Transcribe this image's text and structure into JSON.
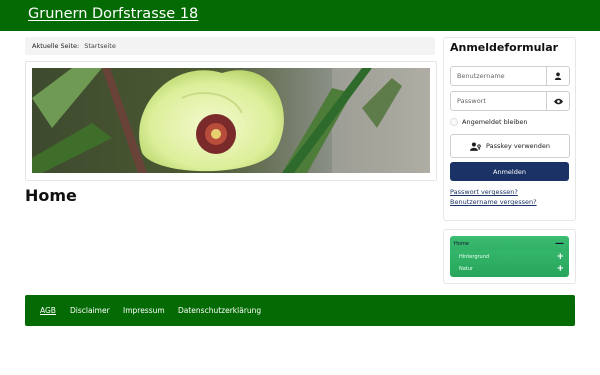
{
  "header": {
    "site_title": "Grunern Dorfstrasse 18"
  },
  "breadcrumb": {
    "label": "Aktuelle Seite:",
    "current": "Startseite"
  },
  "main": {
    "title": "Home"
  },
  "login": {
    "title": "Anmeldeformular",
    "username_placeholder": "Benutzername",
    "password_placeholder": "Passwort",
    "remember_label": "Angemeldet bleiben",
    "passkey_label": "Passkey verwenden",
    "submit_label": "Anmelden",
    "forgot_password": "Passwort vergessen?",
    "forgot_username": "Benutzername vergessen?"
  },
  "nav_menu": {
    "items": [
      {
        "label": "Home",
        "icon": "minus-icon"
      },
      {
        "label": "Hintergrund",
        "icon": "plus-icon"
      },
      {
        "label": "Natur",
        "icon": "plus-icon"
      }
    ]
  },
  "footer": {
    "links": [
      "AGB",
      "Disclaimer",
      "Impressum",
      "Datenschutzerklärung"
    ]
  },
  "colors": {
    "brand_green": "#046b04",
    "submit_navy": "#1b3266",
    "menu_green": "#27a55b"
  }
}
